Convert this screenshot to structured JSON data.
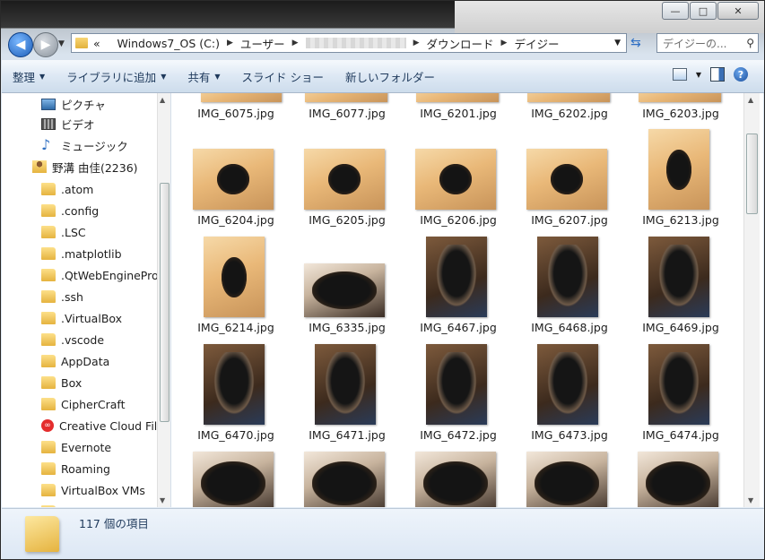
{
  "window": {
    "controls": [
      "—",
      "□",
      "✕"
    ]
  },
  "address": {
    "overflow": "«",
    "crumbs": [
      "Windows7_OS (C:)",
      "ユーザー",
      "",
      "ダウンロード",
      "デイジー"
    ]
  },
  "search": {
    "placeholder": "デイジーの..."
  },
  "toolbar": {
    "organize": "整理",
    "add_library": "ライブラリに追加",
    "share": "共有",
    "slideshow": "スライド ショー",
    "new_folder": "新しいフォルダー"
  },
  "sidebar": {
    "items": [
      {
        "label": "ピクチャ",
        "icon": "picture-icon"
      },
      {
        "label": "ビデオ",
        "icon": "video-icon"
      },
      {
        "label": "ミュージック",
        "icon": "music-icon"
      },
      {
        "label": "野溝 由佳(2236)",
        "icon": "user-folder-icon"
      },
      {
        "label": ".atom",
        "icon": "folder-icon"
      },
      {
        "label": ".config",
        "icon": "folder-icon"
      },
      {
        "label": ".LSC",
        "icon": "folder-icon"
      },
      {
        "label": ".matplotlib",
        "icon": "folder-icon"
      },
      {
        "label": ".QtWebEngineProc",
        "icon": "folder-icon"
      },
      {
        "label": ".ssh",
        "icon": "folder-icon"
      },
      {
        "label": ".VirtualBox",
        "icon": "folder-icon"
      },
      {
        "label": ".vscode",
        "icon": "folder-icon"
      },
      {
        "label": "AppData",
        "icon": "folder-icon"
      },
      {
        "label": "Box",
        "icon": "folder-icon"
      },
      {
        "label": "CipherCraft",
        "icon": "folder-icon"
      },
      {
        "label": "Creative Cloud Files",
        "icon": "creative-cloud-icon"
      },
      {
        "label": "Evernote",
        "icon": "folder-icon"
      },
      {
        "label": "Roaming",
        "icon": "folder-icon"
      },
      {
        "label": "VirtualBox VMs",
        "icon": "folder-icon"
      }
    ]
  },
  "files": {
    "row0": [
      "IMG_6075.jpg",
      "IMG_6077.jpg",
      "IMG_6201.jpg",
      "IMG_6202.jpg",
      "IMG_6203.jpg"
    ],
    "row1": [
      "IMG_6204.jpg",
      "IMG_6205.jpg",
      "IMG_6206.jpg",
      "IMG_6207.jpg",
      "IMG_6213.jpg"
    ],
    "row2": [
      "IMG_6214.jpg",
      "IMG_6335.jpg",
      "IMG_6467.jpg",
      "IMG_6468.jpg",
      "IMG_6469.jpg"
    ],
    "row3": [
      "IMG_6470.jpg",
      "IMG_6471.jpg",
      "IMG_6472.jpg",
      "IMG_6473.jpg",
      "IMG_6474.jpg"
    ],
    "row4": [
      "",
      "",
      "",
      "",
      ""
    ]
  },
  "status": {
    "item_count": "117 個の項目"
  }
}
